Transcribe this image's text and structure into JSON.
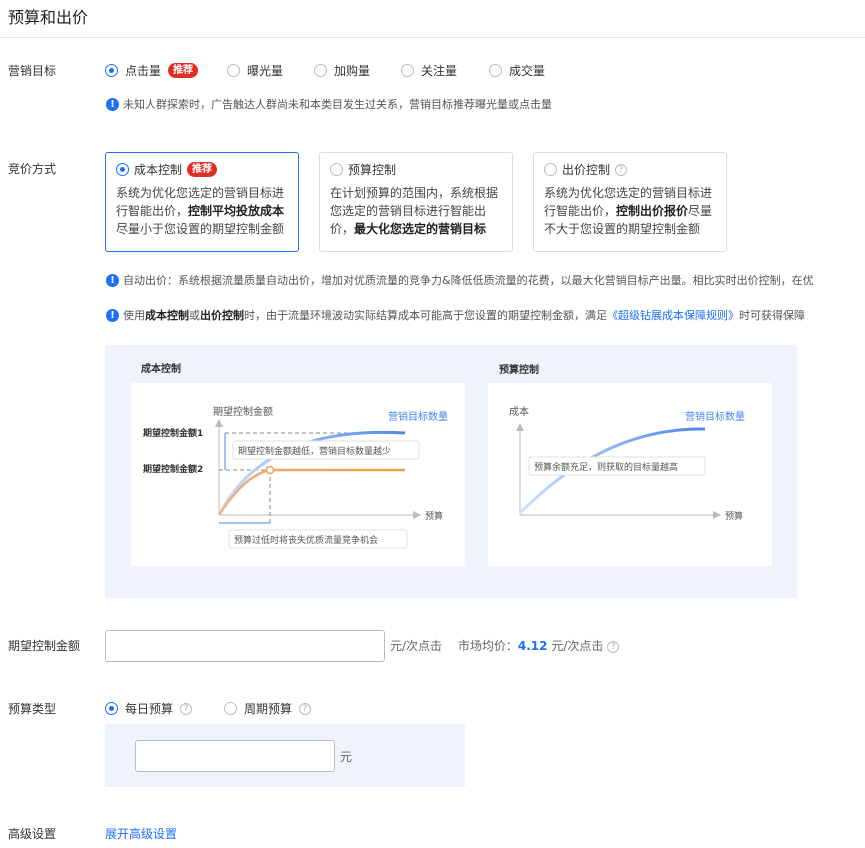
{
  "page_title": "预算和出价",
  "goal": {
    "label": "营销目标",
    "options": [
      {
        "label": "点击量",
        "badge": "推荐",
        "selected": true
      },
      {
        "label": "曝光量",
        "selected": false
      },
      {
        "label": "加购量",
        "selected": false
      },
      {
        "label": "关注量",
        "selected": false
      },
      {
        "label": "成交量",
        "selected": false
      }
    ],
    "tip": "未知人群探索时，广告触达人群尚未和本类目发生过关系，营销目标推荐曝光量或点击量"
  },
  "bid": {
    "label": "竞价方式",
    "cards": [
      {
        "title": "成本控制",
        "badge": "推荐",
        "selected": true,
        "lines": [
          "系统为优化您选定的营销目标进",
          "行智能出价，",
          "控制平均投放成本",
          "尽量小于您设置的期望控制金额"
        ]
      },
      {
        "title": "预算控制",
        "selected": false,
        "lines": [
          "在计划预算的范围内，系统根据",
          "您选定的营销目标进行智能出",
          "价，",
          "最大化您选定的营销目标"
        ]
      },
      {
        "title": "出价控制",
        "selected": false,
        "lines": [
          "系统为优化您选定的营销目标进",
          "行智能出价，",
          "控制出价报价",
          "尽量",
          "不大于您设置的期望控制金额"
        ]
      }
    ],
    "tip1": "自动出价：系统根据流量质量自动出价，增加对优质流量的竞争力&降低低质流量的花费，以最大化营销目标产出量。相比实时出价控制，在优",
    "tip2_pre": "使用",
    "tip2_b1": "成本控制",
    "tip2_mid1": "或",
    "tip2_b2": "出价控制",
    "tip2_mid2": "时，由于流量环境波动实际结算成本可能高于您设置的期望控制金额，满足",
    "tip2_link": "《超级钻展成本保障规则》",
    "tip2_post": "时可获得保障"
  },
  "illustration": {
    "left_title": "成本控制",
    "left_y_axis": "期望控制金额",
    "left_series": "营销目标数量",
    "left_level1": "期望控制金额1",
    "left_level2": "期望控制金额2",
    "left_note_top": "期望控制金额越低，营销目标数量越少",
    "left_note_bottom": "预算过低时将丧失优质流量竞争机会",
    "left_x_axis": "预算",
    "right_title": "预算控制",
    "right_y_axis": "成本",
    "right_series": "营销目标数量",
    "right_note": "预算余额充足，则获取的目标量越高",
    "right_x_axis": "预算",
    "colors": {
      "blue": "#4a86e8",
      "orange": "#f0a04b"
    }
  },
  "expected": {
    "label": "期望控制金额",
    "value": "",
    "unit": "元/次点击",
    "market_prefix": "市场均价：",
    "market_value": "4.12",
    "market_unit": "元/次点击"
  },
  "budget_type": {
    "label": "预算类型",
    "options": [
      {
        "label": "每日预算",
        "selected": true
      },
      {
        "label": "周期预算",
        "selected": false
      }
    ],
    "value": "",
    "unit": "元"
  },
  "advanced": {
    "label": "高级设置",
    "link": "展开高级设置"
  }
}
